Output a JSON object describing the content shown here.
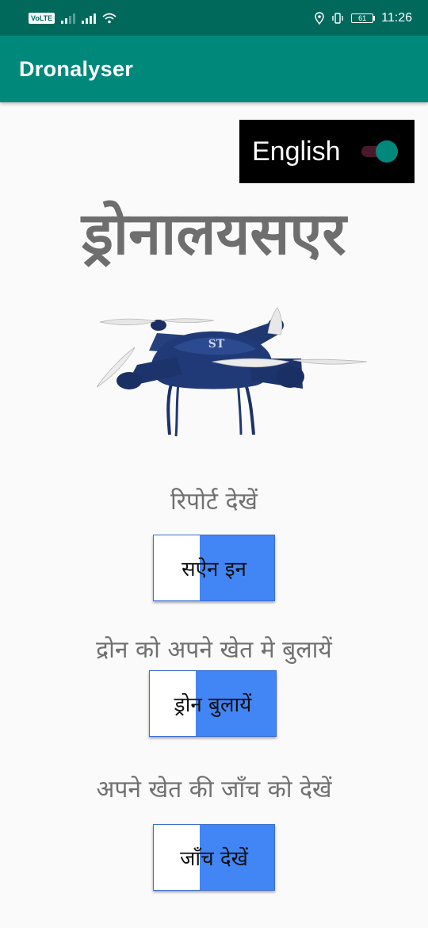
{
  "status_bar": {
    "volte": "VoLTE",
    "battery": "61",
    "time": "11:26",
    "icons": [
      "signal-icon",
      "wifi-icon",
      "location-icon",
      "vibrate-icon",
      "battery-icon"
    ]
  },
  "app_bar": {
    "title": "Dronalyser"
  },
  "language_toggle": {
    "label": "English",
    "checked": true,
    "thumb_color": "#00897b",
    "track_color": "#4a1a2a"
  },
  "main": {
    "big_title": "ड्रोनालयसएर",
    "sections": [
      {
        "label": "रिपोर्ट देखें",
        "button": "सऐन इन"
      },
      {
        "label": "द्रोन को अपने खेत मे बुलायें",
        "button": "ड्रोन बुलायें"
      },
      {
        "label": "अपने खेत की जाँच को देखें",
        "button": "जाँच देखें"
      }
    ]
  },
  "colors": {
    "status_bar": "#00695c",
    "app_bar": "#00897b",
    "button_blue": "#4285f4",
    "background": "#fafafa"
  }
}
